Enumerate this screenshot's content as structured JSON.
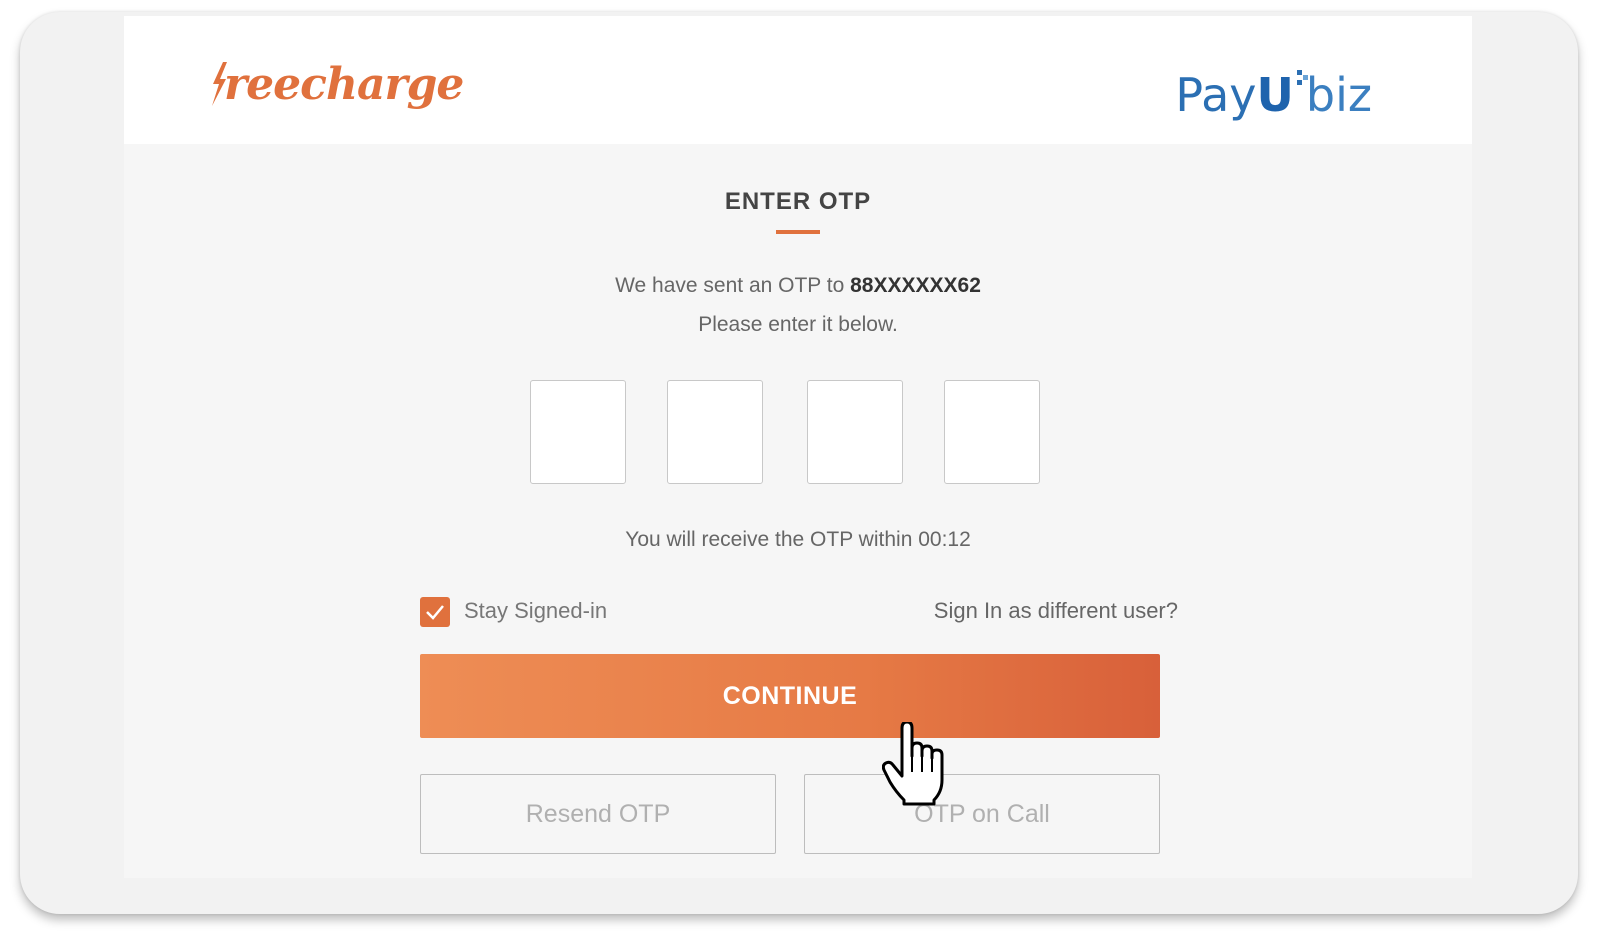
{
  "header": {
    "freecharge_logo_text": "reecharge",
    "payu_prefix": "Pay",
    "payu_u": "U",
    "payu_suffix": "biz"
  },
  "colors": {
    "accent": "#e0713d",
    "payu_blue": "#2b6fb3"
  },
  "otp": {
    "title": "ENTER OTP",
    "sent_prefix": "We have sent an OTP to ",
    "masked_number": "88XXXXXX62",
    "instruction": "Please enter it below.",
    "boxes": [
      "",
      "",
      "",
      ""
    ],
    "timer_text": "You will receive the OTP within 00:12"
  },
  "options": {
    "stay_signed_in_label": "Stay Signed-in",
    "stay_signed_in_checked": true,
    "different_user_link": "Sign In as different user?"
  },
  "actions": {
    "continue_label": "CONTINUE",
    "resend_label": "Resend OTP",
    "call_label": "OTP on Call"
  },
  "icons": {
    "checkbox": "check-icon",
    "cursor": "hand-pointer-cursor-icon"
  }
}
